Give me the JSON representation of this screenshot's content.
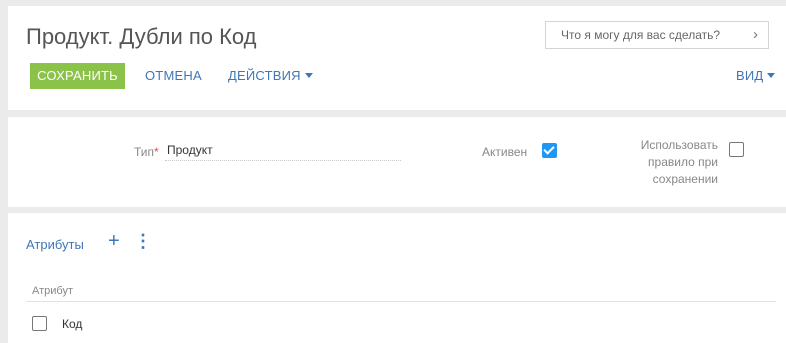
{
  "header": {
    "title": "Продукт. Дубли по Код",
    "assistant_text": "Что я могу для вас сделать?",
    "assistant_icon": "chevron-right-icon"
  },
  "toolbar": {
    "save_label": "СОХРАНИТЬ",
    "cancel_label": "ОТМЕНА",
    "actions_label": "ДЕЙСТВИЯ",
    "view_label": "ВИД",
    "accent_color": "#8bc34a",
    "link_color": "#3f76b8"
  },
  "form": {
    "type_label": "Тип",
    "type_value": "Продукт",
    "active_label": "Активен",
    "active_checked": true,
    "use_rule_label_1": "Использовать",
    "use_rule_label_2": "правило при",
    "use_rule_label_3": "сохранении",
    "use_rule_checked": false
  },
  "attributes": {
    "section_title": "Атрибуты",
    "column_header": "Атрибут",
    "rows": [
      {
        "label": "Код",
        "checked": false
      }
    ]
  }
}
